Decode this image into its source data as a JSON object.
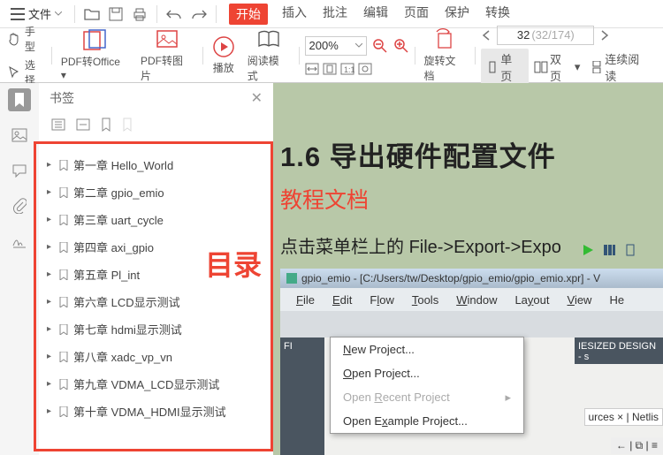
{
  "menubar": {
    "file_label": "文件"
  },
  "tabs": {
    "start": "开始",
    "insert": "插入",
    "review": "批注",
    "edit": "编辑",
    "page": "页面",
    "protect": "保护",
    "convert": "转换"
  },
  "ribbon": {
    "hand": "手型",
    "select": "选择",
    "pdf2office": "PDF转Office",
    "pdf2img": "PDF转图片",
    "play": "播放",
    "readmode": "阅读模式",
    "rotate": "旋转文档",
    "zoom": "200%",
    "page_cur": "32",
    "page_total": "(32/174)",
    "single": "单页",
    "double": "双页",
    "continuous": "连续阅读"
  },
  "bookmark": {
    "title": "书签",
    "catalog": "目录",
    "items": [
      "第一章  Hello_World",
      "第二章 gpio_emio",
      "第三章 uart_cycle",
      "第四章  axi_gpio",
      "第五章  Pl_int",
      "第六章  LCD显示测试",
      "第七章 hdmi显示测试",
      "第八章  xadc_vp_vn",
      "第九章  VDMA_LCD显示测试",
      "第十章  VDMA_HDMI显示测试"
    ]
  },
  "doc": {
    "title": "1.6 导出硬件配置文件",
    "sub": "教程文档",
    "text_prefix": "点击菜单栏上的  ",
    "text_path": "File->Export->Expo"
  },
  "ide": {
    "title": "gpio_emio - [C:/Users/tw/Desktop/gpio_emio/gpio_emio.xpr] - V",
    "menu": {
      "file": "File",
      "edit": "Edit",
      "flow": "Flow",
      "tools": "Tools",
      "window": "Window",
      "layout": "Layout",
      "view": "View",
      "help": "He"
    },
    "popup": {
      "new": "New Project...",
      "open": "Open Project...",
      "recent": "Open Recent Project",
      "example": "Open Example Project..."
    },
    "left": "FI",
    "right": "IESIZED DESIGN - s",
    "tab1": "urces",
    "tab2": "Netlis"
  }
}
